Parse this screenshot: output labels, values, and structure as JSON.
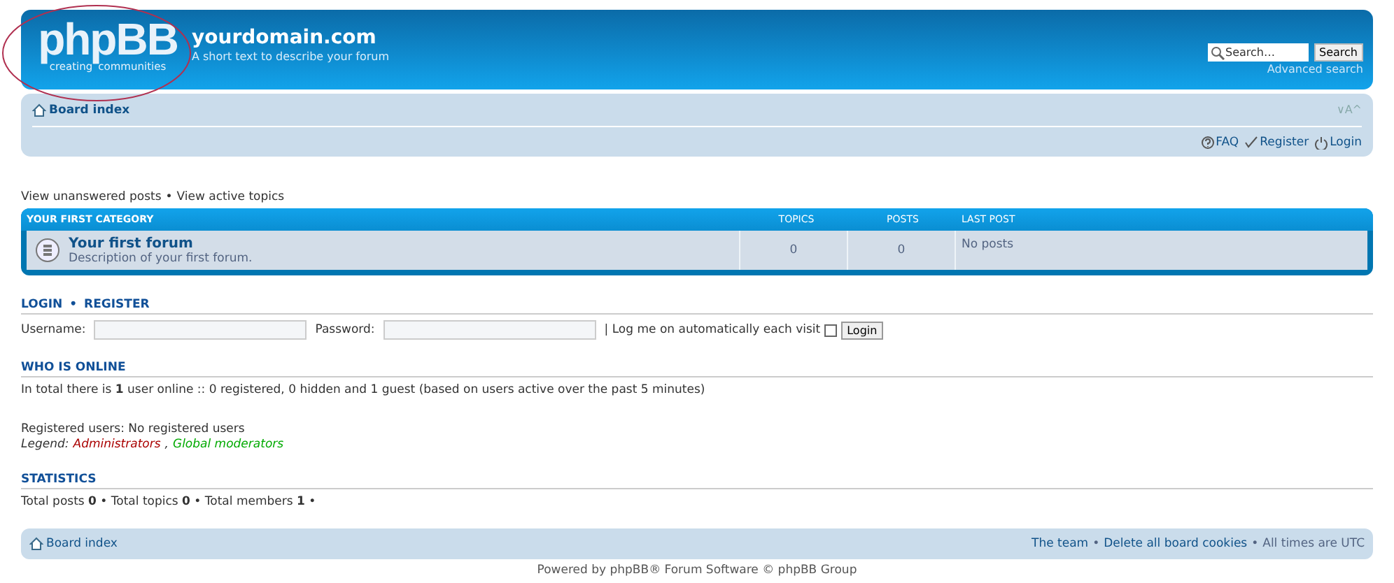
{
  "header": {
    "logo": {
      "word": "phpBB",
      "tagline_left": "creating",
      "tagline_right": "communities"
    },
    "site_title": "yourdomain.com",
    "site_description": "A short text to describe your forum",
    "search": {
      "placeholder": "Search…",
      "button": "Search",
      "advanced": "Advanced search"
    }
  },
  "navbar": {
    "breadcrumb": "Board index",
    "font_controls": "∨A^",
    "links": [
      {
        "kind": "faq",
        "label": "FAQ"
      },
      {
        "kind": "register",
        "label": "Register"
      },
      {
        "kind": "login",
        "label": "Login"
      }
    ]
  },
  "separator": "•",
  "quick_links": [
    "View unanswered posts",
    "View active topics"
  ],
  "forum_table": {
    "columns": [
      "YOUR FIRST CATEGORY",
      "TOPICS",
      "POSTS",
      "LAST POST"
    ],
    "rows": [
      {
        "title": "Your first forum",
        "description": "Description of your first forum.",
        "topics": "0",
        "posts": "0",
        "last_post": "No posts"
      }
    ]
  },
  "login": {
    "heading_links": [
      "LOGIN",
      "REGISTER"
    ],
    "username_label": "Username:",
    "password_label": "Password:",
    "remember_label": "| Log me on automatically each visit",
    "remember_checked": false,
    "button": "Login"
  },
  "who_is_online": {
    "heading": "WHO IS ONLINE",
    "text": "In total there is **1** user online :: 0 registered, 0 hidden and 1 guest (based on users active over the past 5 minutes)",
    "registered": "Registered users: No registered users",
    "legend_label": "Legend:",
    "legend_separator": ",",
    "legend": [
      {
        "label": "Administrators",
        "color": "#aa0000"
      },
      {
        "label": "Global moderators",
        "color": "#00aa00"
      }
    ]
  },
  "statistics": {
    "heading": "STATISTICS",
    "text": "Total posts **0** • Total topics **0** • Total members **1** •"
  },
  "footer": {
    "breadcrumb": "Board index",
    "links": [
      "The team",
      "Delete all board cookies"
    ],
    "timezone": "All times are UTC"
  },
  "powered_by": "Powered by phpBB® Forum Software © phpBB Group"
}
